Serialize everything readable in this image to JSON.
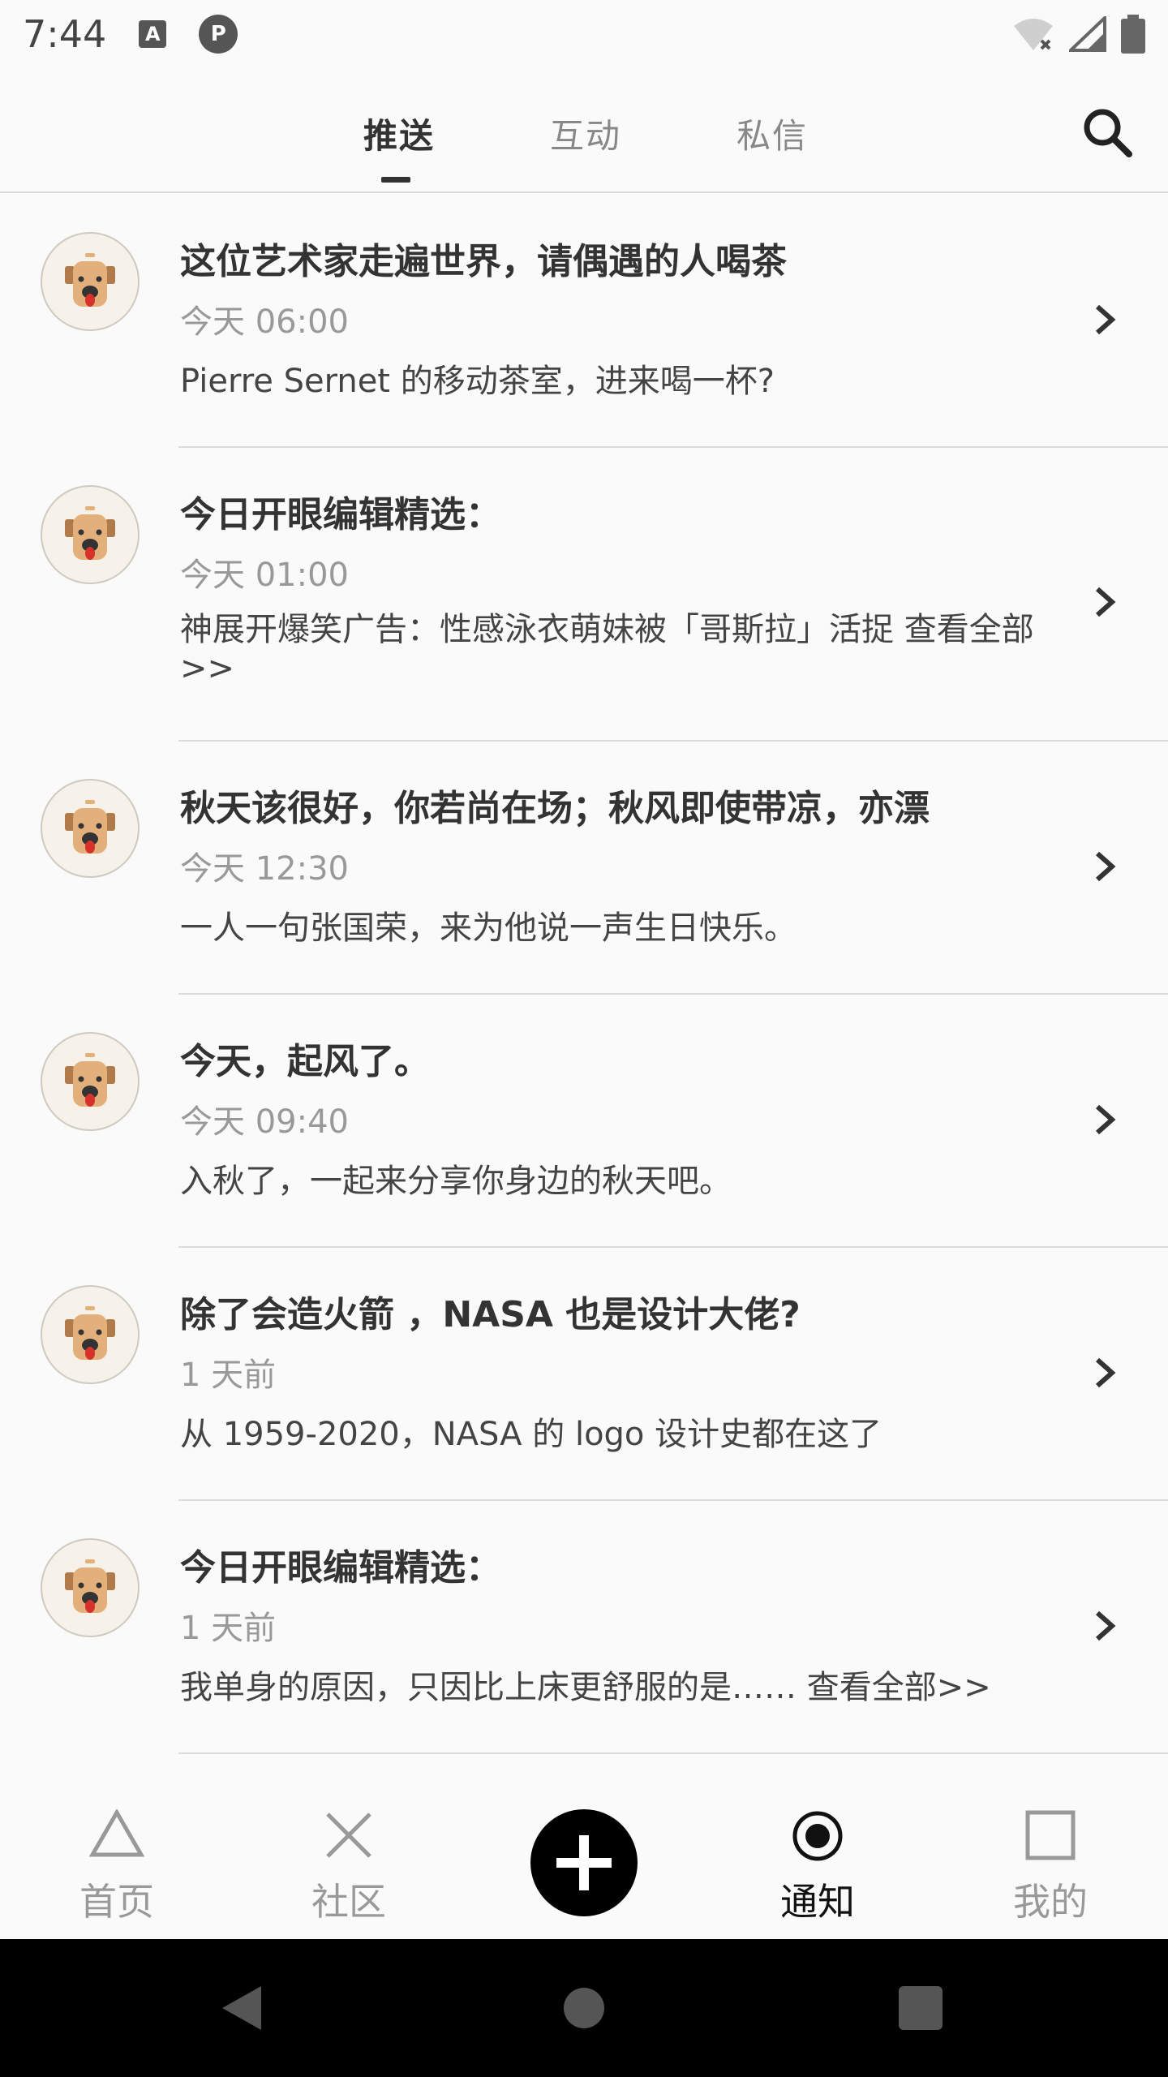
{
  "status_bar": {
    "time": "7:44",
    "icons": [
      "a-icon",
      "p-icon",
      "wifi-icon",
      "signal-icon",
      "battery-icon"
    ]
  },
  "header": {
    "tabs": [
      {
        "label": "推送",
        "active": true
      },
      {
        "label": "互动",
        "active": false
      },
      {
        "label": "私信",
        "active": false
      }
    ],
    "search_icon": "search-icon"
  },
  "notifications": [
    {
      "title": "这位艺术家走遍世界，请偶遇的人喝茶",
      "time": "今天 06:00",
      "desc": "Pierre Sernet 的移动茶室，进来喝一杯?"
    },
    {
      "title": "今日开眼编辑精选：",
      "time": "今天 01:00",
      "desc": "神展开爆笑广告：性感泳衣萌妹被「哥斯拉」活捉 查看全部>>"
    },
    {
      "title": "秋天该很好，你若尚在场；秋风即使带凉，亦漂",
      "time": "今天 12:30",
      "desc": "一人一句张国荣，来为他说一声生日快乐。"
    },
    {
      "title": "今天，起风了。",
      "time": "今天 09:40",
      "desc": "入秋了，一起来分享你身边的秋天吧。"
    },
    {
      "title": "除了会造火箭 ，NASA 也是设计大佬?",
      "time": "1 天前",
      "desc": "从 1959-2020，NASA 的 logo 设计史都在这了"
    },
    {
      "title": "今日开眼编辑精选：",
      "time": "1 天前",
      "desc": "我单身的原因，只因比上床更舒服的是…… 查看全部>>"
    }
  ],
  "bottom_nav": {
    "items": [
      {
        "label": "首页",
        "icon": "triangle-icon",
        "active": false
      },
      {
        "label": "社区",
        "icon": "cross-icon",
        "active": false
      },
      {
        "label": "通知",
        "icon": "circle-dot-icon",
        "active": true
      },
      {
        "label": "我的",
        "icon": "square-icon",
        "active": false
      }
    ],
    "fab_icon": "plus-icon"
  },
  "colors": {
    "background": "#fafafa",
    "text_primary": "#333333",
    "text_secondary": "#999999",
    "divider": "#dcdcdc",
    "accent": "#000000"
  }
}
